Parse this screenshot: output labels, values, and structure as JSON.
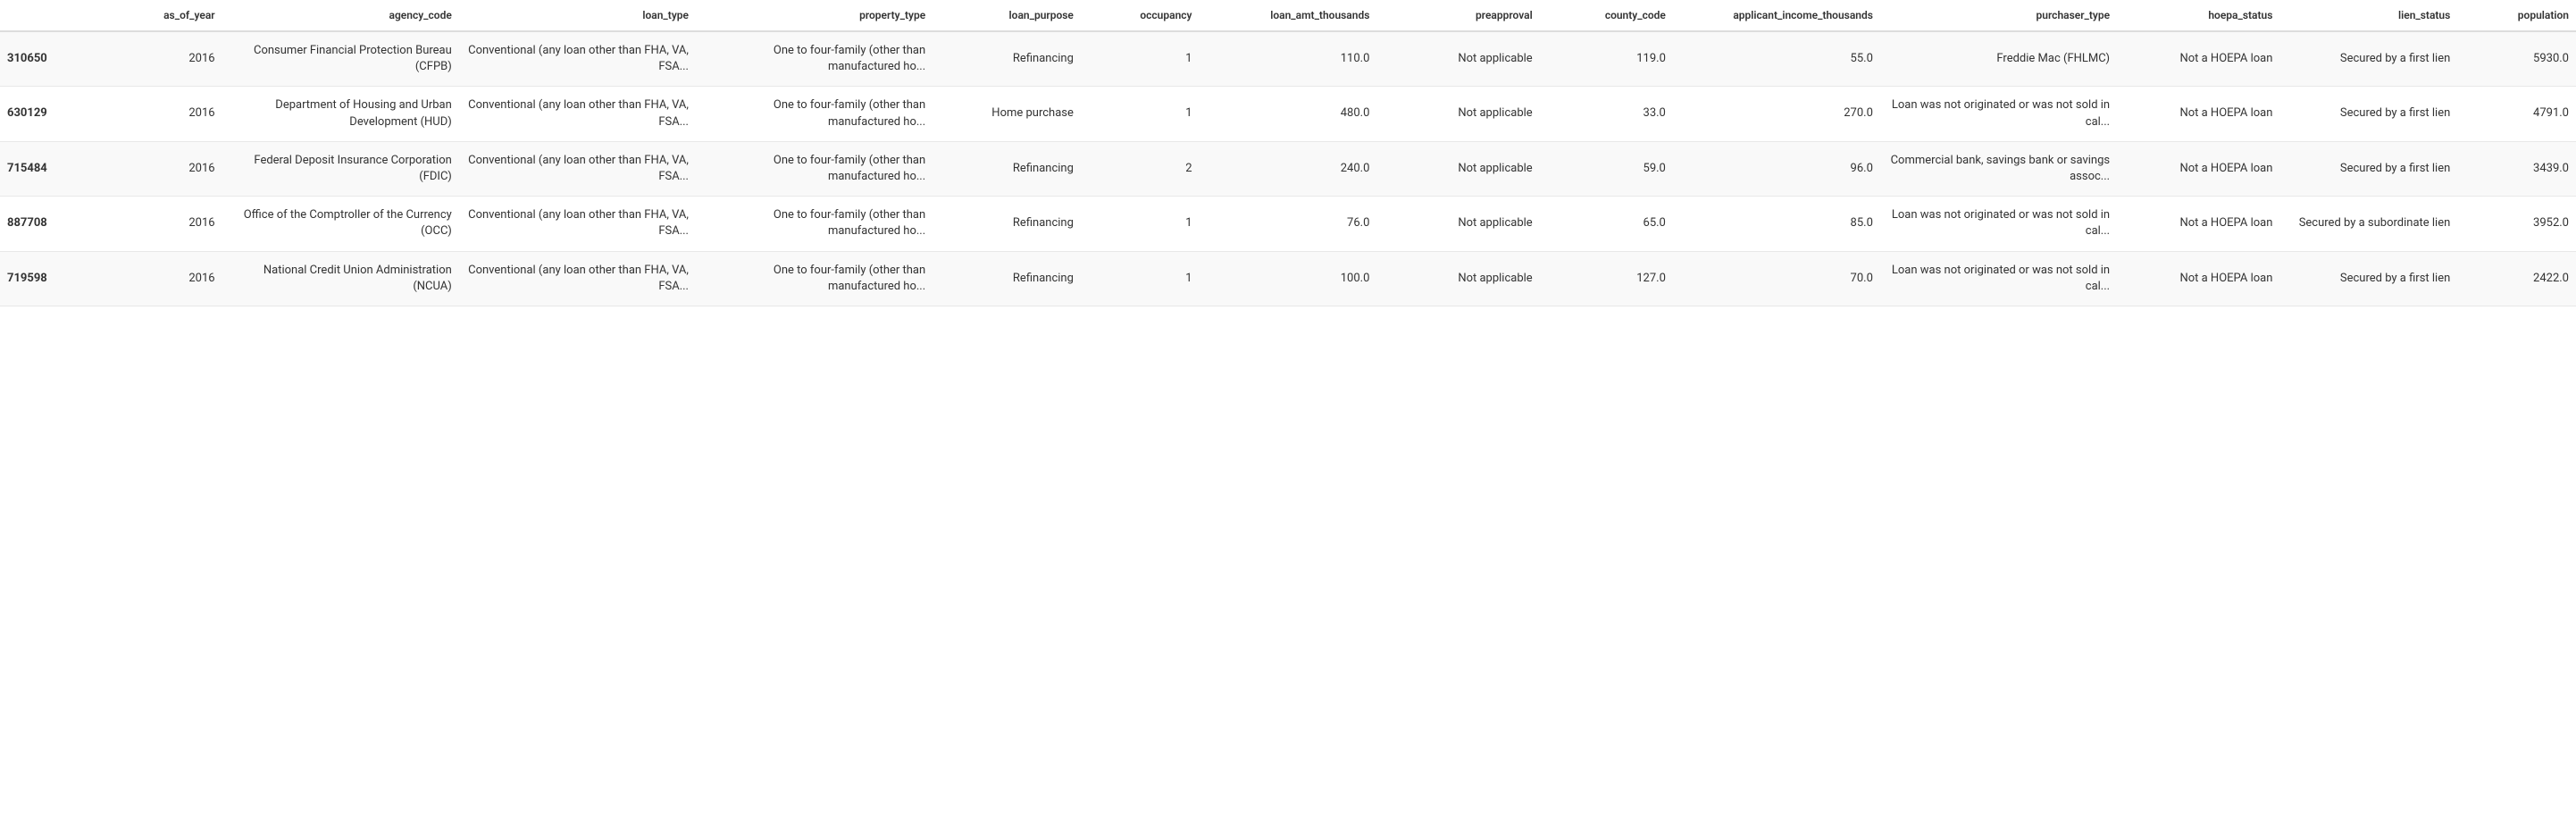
{
  "table": {
    "columns": [
      {
        "key": "index",
        "label": "",
        "class": "col-index"
      },
      {
        "key": "as_of_year",
        "label": "as_of_year",
        "class": "col-as_of_year"
      },
      {
        "key": "agency_code",
        "label": "agency_code",
        "class": "col-agency_code"
      },
      {
        "key": "loan_type",
        "label": "loan_type",
        "class": "col-loan_type"
      },
      {
        "key": "property_type",
        "label": "property_type",
        "class": "col-property_type"
      },
      {
        "key": "loan_purpose",
        "label": "loan_purpose",
        "class": "col-loan_purpose"
      },
      {
        "key": "occupancy",
        "label": "occupancy",
        "class": "col-occupancy"
      },
      {
        "key": "loan_amt_thousands",
        "label": "loan_amt_thousands",
        "class": "col-loan_amt"
      },
      {
        "key": "preapproval",
        "label": "preapproval",
        "class": "col-preapproval"
      },
      {
        "key": "county_code",
        "label": "county_code",
        "class": "col-county_code"
      },
      {
        "key": "applicant_income_thousands",
        "label": "applicant_income_thousands",
        "class": "col-applicant_income"
      },
      {
        "key": "purchaser_type",
        "label": "purchaser_type",
        "class": "col-purchaser_type"
      },
      {
        "key": "hoepa_status",
        "label": "hoepa_status",
        "class": "col-hoepa_status"
      },
      {
        "key": "lien_status",
        "label": "lien_status",
        "class": "col-lien_status"
      },
      {
        "key": "population",
        "label": "population",
        "class": "col-population"
      }
    ],
    "rows": [
      {
        "index": "310650",
        "as_of_year": "2016",
        "agency_code": "Consumer Financial Protection Bureau (CFPB)",
        "loan_type": "Conventional (any loan other than FHA, VA, FSA...",
        "property_type": "One to four-family (other than manufactured ho...",
        "loan_purpose": "Refinancing",
        "occupancy": "1",
        "loan_amt_thousands": "110.0",
        "preapproval": "Not applicable",
        "county_code": "119.0",
        "applicant_income_thousands": "55.0",
        "purchaser_type": "Freddie Mac (FHLMC)",
        "hoepa_status": "Not a HOEPA loan",
        "lien_status": "Secured by a first lien",
        "population": "5930.0"
      },
      {
        "index": "630129",
        "as_of_year": "2016",
        "agency_code": "Department of Housing and Urban Development (HUD)",
        "loan_type": "Conventional (any loan other than FHA, VA, FSA...",
        "property_type": "One to four-family (other than manufactured ho...",
        "loan_purpose": "Home purchase",
        "occupancy": "1",
        "loan_amt_thousands": "480.0",
        "preapproval": "Not applicable",
        "county_code": "33.0",
        "applicant_income_thousands": "270.0",
        "purchaser_type": "Loan was not originated or was not sold in cal...",
        "hoepa_status": "Not a HOEPA loan",
        "lien_status": "Secured by a first lien",
        "population": "4791.0"
      },
      {
        "index": "715484",
        "as_of_year": "2016",
        "agency_code": "Federal Deposit Insurance Corporation (FDIC)",
        "loan_type": "Conventional (any loan other than FHA, VA, FSA...",
        "property_type": "One to four-family (other than manufactured ho...",
        "loan_purpose": "Refinancing",
        "occupancy": "2",
        "loan_amt_thousands": "240.0",
        "preapproval": "Not applicable",
        "county_code": "59.0",
        "applicant_income_thousands": "96.0",
        "purchaser_type": "Commercial bank, savings bank or savings assoc...",
        "hoepa_status": "Not a HOEPA loan",
        "lien_status": "Secured by a first lien",
        "population": "3439.0"
      },
      {
        "index": "887708",
        "as_of_year": "2016",
        "agency_code": "Office of the Comptroller of the Currency (OCC)",
        "loan_type": "Conventional (any loan other than FHA, VA, FSA...",
        "property_type": "One to four-family (other than manufactured ho...",
        "loan_purpose": "Refinancing",
        "occupancy": "1",
        "loan_amt_thousands": "76.0",
        "preapproval": "Not applicable",
        "county_code": "65.0",
        "applicant_income_thousands": "85.0",
        "purchaser_type": "Loan was not originated or was not sold in cal...",
        "hoepa_status": "Not a HOEPA loan",
        "lien_status": "Secured by a subordinate lien",
        "population": "3952.0"
      },
      {
        "index": "719598",
        "as_of_year": "2016",
        "agency_code": "National Credit Union Administration (NCUA)",
        "loan_type": "Conventional (any loan other than FHA, VA, FSA...",
        "property_type": "One to four-family (other than manufactured ho...",
        "loan_purpose": "Refinancing",
        "occupancy": "1",
        "loan_amt_thousands": "100.0",
        "preapproval": "Not applicable",
        "county_code": "127.0",
        "applicant_income_thousands": "70.0",
        "purchaser_type": "Loan was not originated or was not sold in cal...",
        "hoepa_status": "Not a HOEPA loan",
        "lien_status": "Secured by a first lien",
        "population": "2422.0"
      }
    ]
  }
}
